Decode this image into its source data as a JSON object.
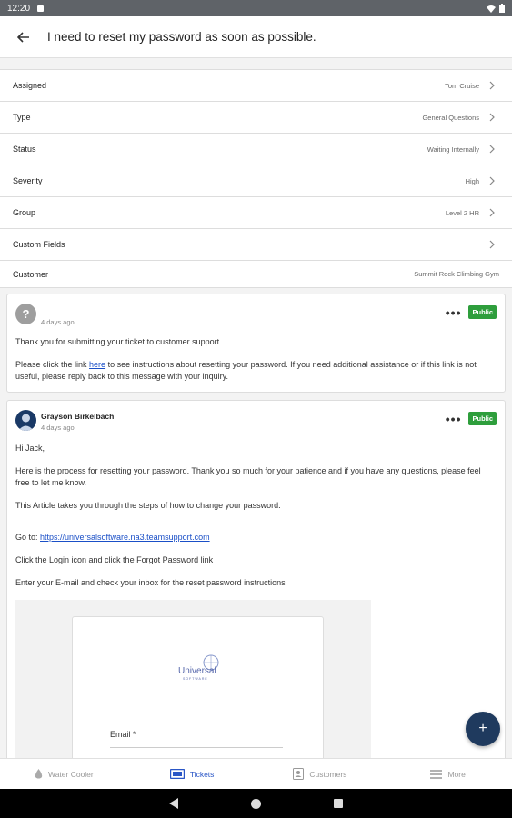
{
  "status_bar": {
    "time": "12:20"
  },
  "header": {
    "title": "I need to reset my password as soon as possible."
  },
  "properties": [
    {
      "label": "Assigned",
      "value": "Tom Cruise",
      "chevron": true
    },
    {
      "label": "Type",
      "value": "General Questions",
      "chevron": true
    },
    {
      "label": "Status",
      "value": "Waiting Internally",
      "chevron": true
    },
    {
      "label": "Severity",
      "value": "High",
      "chevron": true
    },
    {
      "label": "Group",
      "value": "Level 2 HR",
      "chevron": true
    },
    {
      "label": "Custom Fields",
      "value": "",
      "chevron": true
    },
    {
      "label": "Customer",
      "value": "Summit Rock Climbing Gym",
      "chevron": false
    }
  ],
  "messages": [
    {
      "author": "",
      "time": "4 days ago",
      "badge": "Public",
      "line1": "Thank you for submitting your ticket to customer support.",
      "line2_pre": "Please click the link ",
      "line2_link": "here",
      "line2_post": " to see instructions about resetting your password. If you need additional assistance or if this link is not useful, please reply back to this message with your inquiry."
    },
    {
      "author": "Grayson Birkelbach",
      "time": "4 days ago",
      "badge": "Public",
      "greeting": "Hi Jack,",
      "para1": "Here is the process for resetting your password. Thank you so much for your patience and if you have any questions, please feel free to let me know.",
      "para2": "This Article takes you through the steps of how to change your password.",
      "goto_label": "Go to: ",
      "goto_link": "https://universalsoftware.na3.teamsupport.com",
      "step1": "Click the Login icon and click the Forgot Password link",
      "step2": "Enter your E-mail and check your inbox for the reset password instructions",
      "embed": {
        "logo_text": "Universal",
        "logo_sub": "SOFTWARE",
        "email_label": "Email *"
      }
    }
  ],
  "fab": {
    "label": "+"
  },
  "bottom_nav": [
    {
      "label": "Water Cooler",
      "icon": "drop-icon"
    },
    {
      "label": "Tickets",
      "icon": "ticket-icon"
    },
    {
      "label": "Customers",
      "icon": "contact-icon"
    },
    {
      "label": "More",
      "icon": "menu-icon"
    }
  ],
  "colors": {
    "accent": "#2a56c6",
    "badge": "#2e9e3c",
    "fab": "#1f3a5e"
  }
}
